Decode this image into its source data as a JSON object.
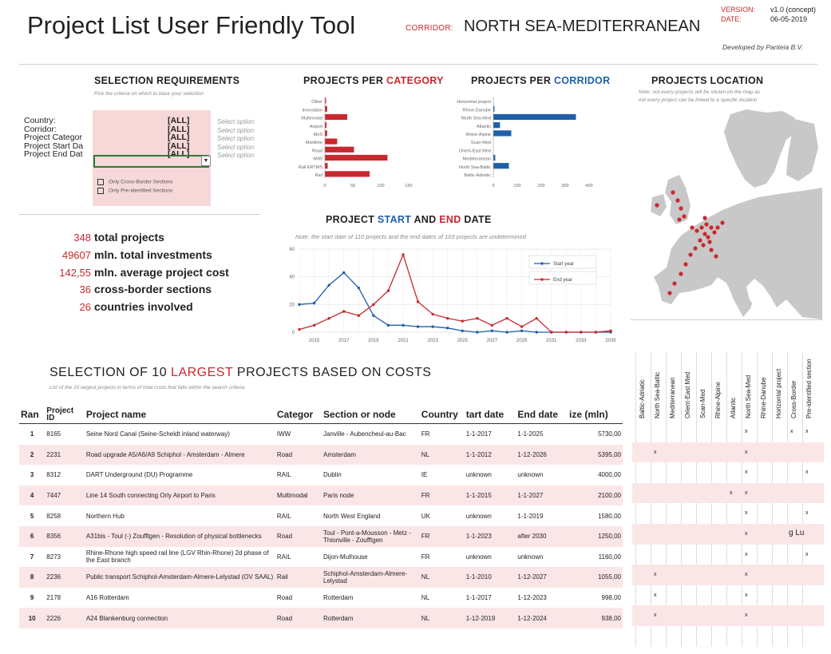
{
  "header": {
    "title": "Project List User Friendly Tool",
    "corridor_label": "CORRIDOR:",
    "corridor_value": "NORTH SEA-MEDITERRANEAN",
    "version_label": "VERSION:",
    "version_value": "v1.0 (concept)",
    "date_label": "DATE:",
    "date_value": "06-05-2019",
    "developer": "Developed by Panteia B.V."
  },
  "selection": {
    "title": "SELECTION REQUIREMENTS",
    "note": "Pick the criteria on which to base your selection",
    "rows": [
      {
        "label": "Country:",
        "value": "[ALL]",
        "hint": "Select option"
      },
      {
        "label": "Corridor:",
        "value": "[ALL]",
        "hint": "Select option"
      },
      {
        "label": "Project Categor",
        "value": "[ALL]",
        "hint": "Select option"
      },
      {
        "label": "Project Start Da",
        "value": "[ALL]",
        "hint": "Select option"
      },
      {
        "label": "Project End Dat",
        "value": "[ALL]",
        "hint": "Select option"
      }
    ],
    "dropdown_icon": "chevron-down-icon",
    "checkbox_cross_border": "Only Cross-Border Sections",
    "checkbox_pre_identified": "Only Pre-identified Sections"
  },
  "stats": [
    {
      "value": "348",
      "label": "total projects"
    },
    {
      "value": "49607",
      "label": "mln. total investments"
    },
    {
      "value": "142,55",
      "label": "mln. average project cost"
    },
    {
      "value": "36",
      "label": "cross-border sections"
    },
    {
      "value": "26",
      "label": "countries involved"
    }
  ],
  "category_chart_title": {
    "a": "PROJECTS PER ",
    "b": "CATEGORY"
  },
  "corridor_chart_title": {
    "a": "PROJECTS PER ",
    "b": "CORRIDOR"
  },
  "location": {
    "title": "PROJECTS LOCATION",
    "note_1": "Note: not every projects will be shown on the map as",
    "note_2": "not every project can be linked to a specific location"
  },
  "timeline_title": {
    "a": "PROJECT ",
    "b": "START",
    "c": " AND ",
    "d": "END",
    "e": " DATE"
  },
  "timeline_note": "Note: the start date of 110 projects and the end dates of 103 projects are undetermined",
  "table_title": {
    "a": "SELECTION OF 10 ",
    "b": "LARGEST",
    "c": " PROJECTS BASED ON COSTS"
  },
  "table_note": "List of the 10 largest projects in terms of total costs that falls within the search criteria",
  "table": {
    "columns": [
      "Ran",
      "Project ID",
      "Project name",
      "Categor",
      "Section or node",
      "Country",
      "tart date",
      "End date",
      "ize (mln)"
    ],
    "rows": [
      [
        "1",
        "8165",
        "Seine Nord Canal (Seine-Scheldt inland waterway)",
        "IWW",
        "Janville - Aubencheul-au-Bac",
        "FR",
        "1-1-2017",
        "1-1-2025",
        "5730,00"
      ],
      [
        "2",
        "2231",
        "Road upgrade A5/A6/A9 Schiphol - Amsterdam - Almere",
        "Road",
        "Amsterdam",
        "NL",
        "1-1-2012",
        "1-12-2026",
        "5395,00"
      ],
      [
        "3",
        "8312",
        "DART Underground (DU) Programme",
        "RAIL",
        "Dublin",
        "IE",
        "unknown",
        "unknown",
        "4000,00"
      ],
      [
        "4",
        "7447",
        "Line 14 South connecting Orly Airport to Paris",
        "Multimodal",
        "Paris node",
        "FR",
        "1-1-2015",
        "1-1-2027",
        "2100,00"
      ],
      [
        "5",
        "8258",
        "Northern Hub",
        "RAIL",
        "North West England",
        "UK",
        "unknown",
        "1-1-2019",
        "1580,00"
      ],
      [
        "6",
        "8356",
        "A31bis - Toul (-) Zoufftgen - Resolution of physical bottlenecks",
        "Road",
        "Toul - Pont-a-Mousson - Metz - Thionville - Zoufftgen",
        "FR",
        "1-1-2023",
        "after 2030",
        "1250,00"
      ],
      [
        "7",
        "8273",
        "Rhine-Rhone high speed rail line (LGV Rhin-Rhone) 2d phase of the East branch",
        "RAIL",
        "Dijon-Mulhouse",
        "FR",
        "unknown",
        "unknown",
        "1160,00"
      ],
      [
        "8",
        "2236",
        "Public transport Schiphol-Amsterdam-Almere-Lelystad (OV SAAL)",
        "Rail",
        "Schiphol-Amsterdam-Almere-Lelystad",
        "NL",
        "1-1-2010",
        "1-12-2027",
        "1055,00"
      ],
      [
        "9",
        "2178",
        "A16 Rotterdam",
        "Road",
        "Rotterdam",
        "NL",
        "1-1-2017",
        "1-12-2023",
        "998,00"
      ],
      [
        "10",
        "2226",
        "A24 Blankenburg connection",
        "Road",
        "Rotterdam",
        "NL",
        "1-12-2019",
        "1-12-2024",
        "938,00"
      ]
    ]
  },
  "flags": {
    "headers": [
      "Baltic-Adriatic",
      "North Sea-Baltic",
      "Mediterranean",
      "Orient-East Med",
      "Scan-Med",
      "Rhine-Alpine",
      "Atlantic",
      "North Sea-Med",
      "Rhine-Danube",
      "Horizontal project",
      "Cross-Border",
      "Pre-identified section"
    ],
    "mark": "x",
    "overflow_text": "g Lu",
    "rows": [
      [
        0,
        0,
        0,
        0,
        0,
        0,
        0,
        1,
        0,
        0,
        1,
        1
      ],
      [
        0,
        1,
        0,
        0,
        0,
        0,
        0,
        1,
        0,
        0,
        0,
        0
      ],
      [
        0,
        0,
        0,
        0,
        0,
        0,
        0,
        1,
        0,
        0,
        0,
        1
      ],
      [
        0,
        0,
        0,
        0,
        0,
        0,
        1,
        1,
        0,
        0,
        0,
        0
      ],
      [
        0,
        0,
        0,
        0,
        0,
        0,
        0,
        1,
        0,
        0,
        0,
        1
      ],
      [
        0,
        0,
        0,
        0,
        0,
        0,
        0,
        1,
        0,
        0,
        0,
        0
      ],
      [
        0,
        0,
        0,
        0,
        0,
        0,
        0,
        1,
        0,
        0,
        0,
        1
      ],
      [
        0,
        1,
        0,
        0,
        0,
        0,
        0,
        1,
        0,
        0,
        0,
        0
      ],
      [
        0,
        1,
        0,
        0,
        0,
        0,
        0,
        1,
        0,
        0,
        0,
        0
      ],
      [
        0,
        1,
        0,
        0,
        0,
        0,
        0,
        1,
        0,
        0,
        0,
        0
      ]
    ]
  },
  "colors": {
    "red": "#c8282e",
    "blue": "#1f5fa8",
    "pink": "#f6d8d9",
    "map_land": "#c8c8c8"
  },
  "chart_data": [
    {
      "type": "bar",
      "orientation": "horizontal",
      "categories": [
        "Other",
        "Innovation",
        "Multimodal",
        "Airport",
        "MoS",
        "Maritime",
        "Road",
        "IWW",
        "Rail ERTMS",
        "Rail"
      ],
      "values": [
        2,
        4,
        40,
        3,
        4,
        22,
        52,
        112,
        5,
        80
      ],
      "xticks": [
        "0",
        "50",
        "100",
        "150"
      ],
      "xlim": [
        0,
        150
      ],
      "color": "#c8282e"
    },
    {
      "type": "bar",
      "orientation": "horizontal",
      "categories": [
        "Horizontal project",
        "Rhine-Danube",
        "North Sea-Med",
        "Atlantic",
        "Rhine-Alpine",
        "Scan-Med",
        "Orient-East Med",
        "Mediterranean",
        "North Sea-Baltic",
        "Baltic-Adriatic"
      ],
      "values": [
        0,
        5,
        345,
        28,
        75,
        0,
        0,
        8,
        65,
        0
      ],
      "xticks": [
        "0",
        "100",
        "200",
        "300",
        "400"
      ],
      "xlim": [
        0,
        400
      ],
      "color": "#1f5fa8"
    },
    {
      "type": "line",
      "x": [
        2014,
        2015,
        2016,
        2017,
        2018,
        2019,
        2020,
        2021,
        2022,
        2023,
        2024,
        2025,
        2026,
        2027,
        2028,
        2029,
        2030,
        2031,
        2032,
        2033,
        2034,
        2035
      ],
      "xticks": [
        "2015",
        "2017",
        "2019",
        "2021",
        "2023",
        "2025",
        "2027",
        "2029",
        "2031",
        "2033",
        "2035"
      ],
      "yticks": [
        "0",
        "20",
        "40",
        "60"
      ],
      "ylim": [
        0,
        60
      ],
      "series": [
        {
          "name": "Start year",
          "color": "#1f5fa8",
          "values": [
            20,
            21,
            34,
            43,
            32,
            12,
            5,
            5,
            4,
            4,
            3,
            1,
            0,
            1,
            0,
            1,
            0,
            0,
            0,
            0,
            0,
            0
          ]
        },
        {
          "name": "End year",
          "color": "#c8282e",
          "values": [
            2,
            5,
            10,
            15,
            12,
            20,
            30,
            56,
            22,
            13,
            10,
            8,
            10,
            5,
            10,
            4,
            10,
            0,
            0,
            0,
            0,
            1
          ]
        }
      ]
    }
  ]
}
